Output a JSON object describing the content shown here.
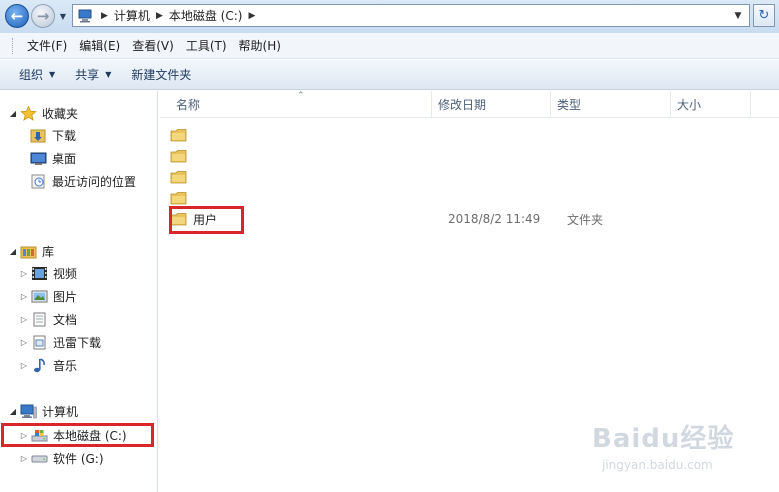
{
  "address_bar": {
    "breadcrumbs": [
      "计算机",
      "本地磁盘 (C:)"
    ]
  },
  "menu": {
    "items": [
      "文件(F)",
      "编辑(E)",
      "查看(V)",
      "工具(T)",
      "帮助(H)"
    ]
  },
  "commands": {
    "organize": "组织",
    "share": "共享",
    "new_folder": "新建文件夹"
  },
  "nav": {
    "favorites": {
      "label": "收藏夹",
      "items": [
        "下载",
        "桌面",
        "最近访问的位置"
      ]
    },
    "libraries": {
      "label": "库",
      "items": [
        "视频",
        "图片",
        "文档",
        "迅雷下载",
        "音乐"
      ]
    },
    "computer": {
      "label": "计算机",
      "items": [
        "本地磁盘 (C:)",
        "软件 (G:)"
      ]
    }
  },
  "columns": {
    "name": "名称",
    "modified": "修改日期",
    "type": "类型",
    "size": "大小"
  },
  "files": [
    {
      "name": "",
      "date": "",
      "type": ""
    },
    {
      "name": "",
      "date": "",
      "type": ""
    },
    {
      "name": "",
      "date": "",
      "type": ""
    },
    {
      "name": "",
      "date": "",
      "type": ""
    },
    {
      "name": "用户",
      "date": "2018/8/2 11:49",
      "type": "文件夹"
    }
  ],
  "watermark": {
    "logo": "Baidu经验",
    "url": "jingyan.baidu.com"
  },
  "colors": {
    "highlight": "#d9262b",
    "folder": "#e8c25a",
    "accent": "#1c5fb8"
  },
  "icons": {
    "back": "back-arrow-icon",
    "forward": "forward-arrow-icon",
    "refresh": "refresh-icon",
    "folder": "folder-icon",
    "star": "star-icon"
  }
}
